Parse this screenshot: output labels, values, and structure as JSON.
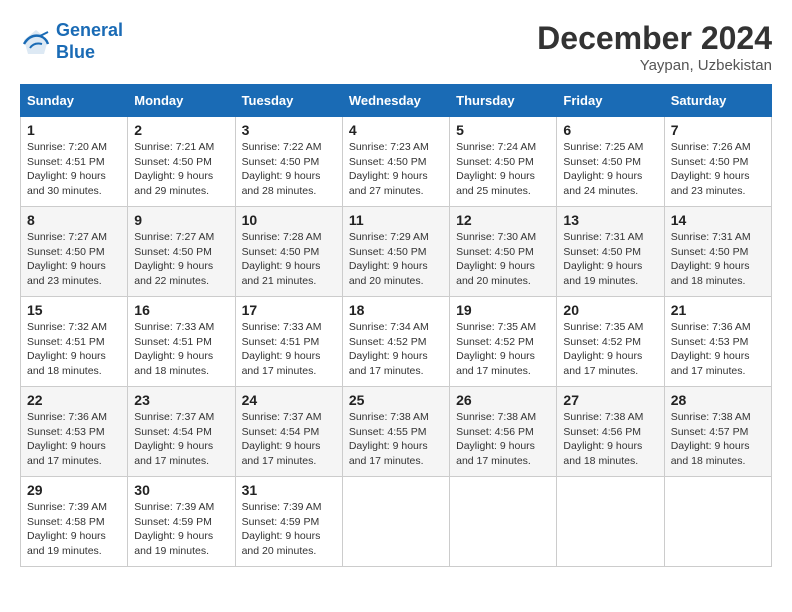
{
  "header": {
    "logo_line1": "General",
    "logo_line2": "Blue",
    "month": "December 2024",
    "location": "Yaypan, Uzbekistan"
  },
  "days_of_week": [
    "Sunday",
    "Monday",
    "Tuesday",
    "Wednesday",
    "Thursday",
    "Friday",
    "Saturday"
  ],
  "weeks": [
    [
      {
        "day": "1",
        "info": "Sunrise: 7:20 AM\nSunset: 4:51 PM\nDaylight: 9 hours\nand 30 minutes."
      },
      {
        "day": "2",
        "info": "Sunrise: 7:21 AM\nSunset: 4:50 PM\nDaylight: 9 hours\nand 29 minutes."
      },
      {
        "day": "3",
        "info": "Sunrise: 7:22 AM\nSunset: 4:50 PM\nDaylight: 9 hours\nand 28 minutes."
      },
      {
        "day": "4",
        "info": "Sunrise: 7:23 AM\nSunset: 4:50 PM\nDaylight: 9 hours\nand 27 minutes."
      },
      {
        "day": "5",
        "info": "Sunrise: 7:24 AM\nSunset: 4:50 PM\nDaylight: 9 hours\nand 25 minutes."
      },
      {
        "day": "6",
        "info": "Sunrise: 7:25 AM\nSunset: 4:50 PM\nDaylight: 9 hours\nand 24 minutes."
      },
      {
        "day": "7",
        "info": "Sunrise: 7:26 AM\nSunset: 4:50 PM\nDaylight: 9 hours\nand 23 minutes."
      }
    ],
    [
      {
        "day": "8",
        "info": "Sunrise: 7:27 AM\nSunset: 4:50 PM\nDaylight: 9 hours\nand 23 minutes."
      },
      {
        "day": "9",
        "info": "Sunrise: 7:27 AM\nSunset: 4:50 PM\nDaylight: 9 hours\nand 22 minutes."
      },
      {
        "day": "10",
        "info": "Sunrise: 7:28 AM\nSunset: 4:50 PM\nDaylight: 9 hours\nand 21 minutes."
      },
      {
        "day": "11",
        "info": "Sunrise: 7:29 AM\nSunset: 4:50 PM\nDaylight: 9 hours\nand 20 minutes."
      },
      {
        "day": "12",
        "info": "Sunrise: 7:30 AM\nSunset: 4:50 PM\nDaylight: 9 hours\nand 20 minutes."
      },
      {
        "day": "13",
        "info": "Sunrise: 7:31 AM\nSunset: 4:50 PM\nDaylight: 9 hours\nand 19 minutes."
      },
      {
        "day": "14",
        "info": "Sunrise: 7:31 AM\nSunset: 4:50 PM\nDaylight: 9 hours\nand 18 minutes."
      }
    ],
    [
      {
        "day": "15",
        "info": "Sunrise: 7:32 AM\nSunset: 4:51 PM\nDaylight: 9 hours\nand 18 minutes."
      },
      {
        "day": "16",
        "info": "Sunrise: 7:33 AM\nSunset: 4:51 PM\nDaylight: 9 hours\nand 18 minutes."
      },
      {
        "day": "17",
        "info": "Sunrise: 7:33 AM\nSunset: 4:51 PM\nDaylight: 9 hours\nand 17 minutes."
      },
      {
        "day": "18",
        "info": "Sunrise: 7:34 AM\nSunset: 4:52 PM\nDaylight: 9 hours\nand 17 minutes."
      },
      {
        "day": "19",
        "info": "Sunrise: 7:35 AM\nSunset: 4:52 PM\nDaylight: 9 hours\nand 17 minutes."
      },
      {
        "day": "20",
        "info": "Sunrise: 7:35 AM\nSunset: 4:52 PM\nDaylight: 9 hours\nand 17 minutes."
      },
      {
        "day": "21",
        "info": "Sunrise: 7:36 AM\nSunset: 4:53 PM\nDaylight: 9 hours\nand 17 minutes."
      }
    ],
    [
      {
        "day": "22",
        "info": "Sunrise: 7:36 AM\nSunset: 4:53 PM\nDaylight: 9 hours\nand 17 minutes."
      },
      {
        "day": "23",
        "info": "Sunrise: 7:37 AM\nSunset: 4:54 PM\nDaylight: 9 hours\nand 17 minutes."
      },
      {
        "day": "24",
        "info": "Sunrise: 7:37 AM\nSunset: 4:54 PM\nDaylight: 9 hours\nand 17 minutes."
      },
      {
        "day": "25",
        "info": "Sunrise: 7:38 AM\nSunset: 4:55 PM\nDaylight: 9 hours\nand 17 minutes."
      },
      {
        "day": "26",
        "info": "Sunrise: 7:38 AM\nSunset: 4:56 PM\nDaylight: 9 hours\nand 17 minutes."
      },
      {
        "day": "27",
        "info": "Sunrise: 7:38 AM\nSunset: 4:56 PM\nDaylight: 9 hours\nand 18 minutes."
      },
      {
        "day": "28",
        "info": "Sunrise: 7:38 AM\nSunset: 4:57 PM\nDaylight: 9 hours\nand 18 minutes."
      }
    ],
    [
      {
        "day": "29",
        "info": "Sunrise: 7:39 AM\nSunset: 4:58 PM\nDaylight: 9 hours\nand 19 minutes."
      },
      {
        "day": "30",
        "info": "Sunrise: 7:39 AM\nSunset: 4:59 PM\nDaylight: 9 hours\nand 19 minutes."
      },
      {
        "day": "31",
        "info": "Sunrise: 7:39 AM\nSunset: 4:59 PM\nDaylight: 9 hours\nand 20 minutes."
      },
      {
        "day": "",
        "info": ""
      },
      {
        "day": "",
        "info": ""
      },
      {
        "day": "",
        "info": ""
      },
      {
        "day": "",
        "info": ""
      }
    ]
  ]
}
